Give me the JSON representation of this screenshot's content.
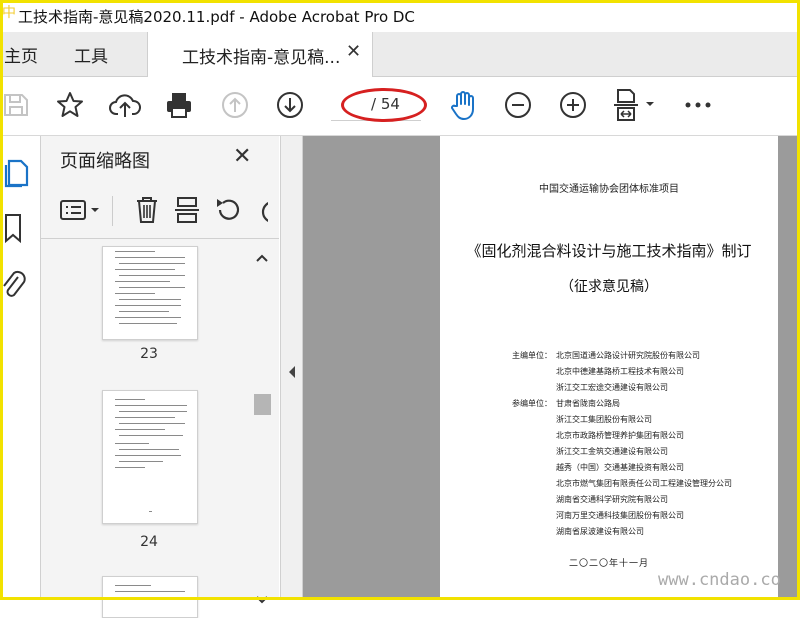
{
  "window": {
    "title": "工技术指南-意见稿2020.11.pdf - Adobe Acrobat Pro DC",
    "watermark_logo": "中"
  },
  "tabs": {
    "home": "主页",
    "tools": "工具",
    "document": "工技术指南-意见稿...",
    "close_glyph": "✕"
  },
  "toolbar": {
    "page_counter": "/ 54",
    "icons": [
      "save-icon",
      "star-icon",
      "upload-cloud-icon",
      "print-icon",
      "prev-page-icon",
      "next-page-icon",
      "hand-icon",
      "zoom-out-icon",
      "zoom-in-icon",
      "fit-page-icon",
      "more-icon"
    ]
  },
  "nav_rail": {
    "icons": [
      "page-thumbnails-icon",
      "bookmark-icon",
      "attachment-icon"
    ]
  },
  "thumbnails_panel": {
    "title": "页面缩略图",
    "close_glyph": "✕",
    "tools": [
      "options-menu-icon",
      "delete-icon",
      "insert-page-icon",
      "rotate-icon"
    ],
    "pages": [
      {
        "number": "23"
      },
      {
        "number": "24"
      }
    ]
  },
  "document": {
    "association": "中国交通运输协会团体标准项目",
    "title": "《固化剂混合料设计与施工技术指南》制订",
    "subtitle": "（征求意见稿）",
    "chief_label": "主编单位：",
    "chief_units": [
      "北京国道通公路设计研究院股份有限公司",
      "北京中德建基路桥工程技术有限公司",
      "浙江交工宏途交通建设有限公司"
    ],
    "participant_label": "参编单位：",
    "participant_units": [
      "甘肃省陇南公路局",
      "浙江交工集团股份有限公司",
      "北京市政路桥管理养护集团有限公司",
      "浙江交工金筑交通建设有限公司",
      "越秀（中国）交通基建投资有限公司",
      "北京市燃气集团有限责任公司工程建设管理分公司",
      "湖南省交通科学研究院有限公司",
      "河南万里交通科技集团股份有限公司",
      "湖南省尿波建设有限公司"
    ],
    "date": "二〇二〇年十一月"
  },
  "overlay": {
    "site_watermark": "www.cndao.co"
  },
  "colors": {
    "accent_blue": "#1a73c7",
    "highlight_oval": "#d62020",
    "border_yellow": "#f2e200"
  }
}
